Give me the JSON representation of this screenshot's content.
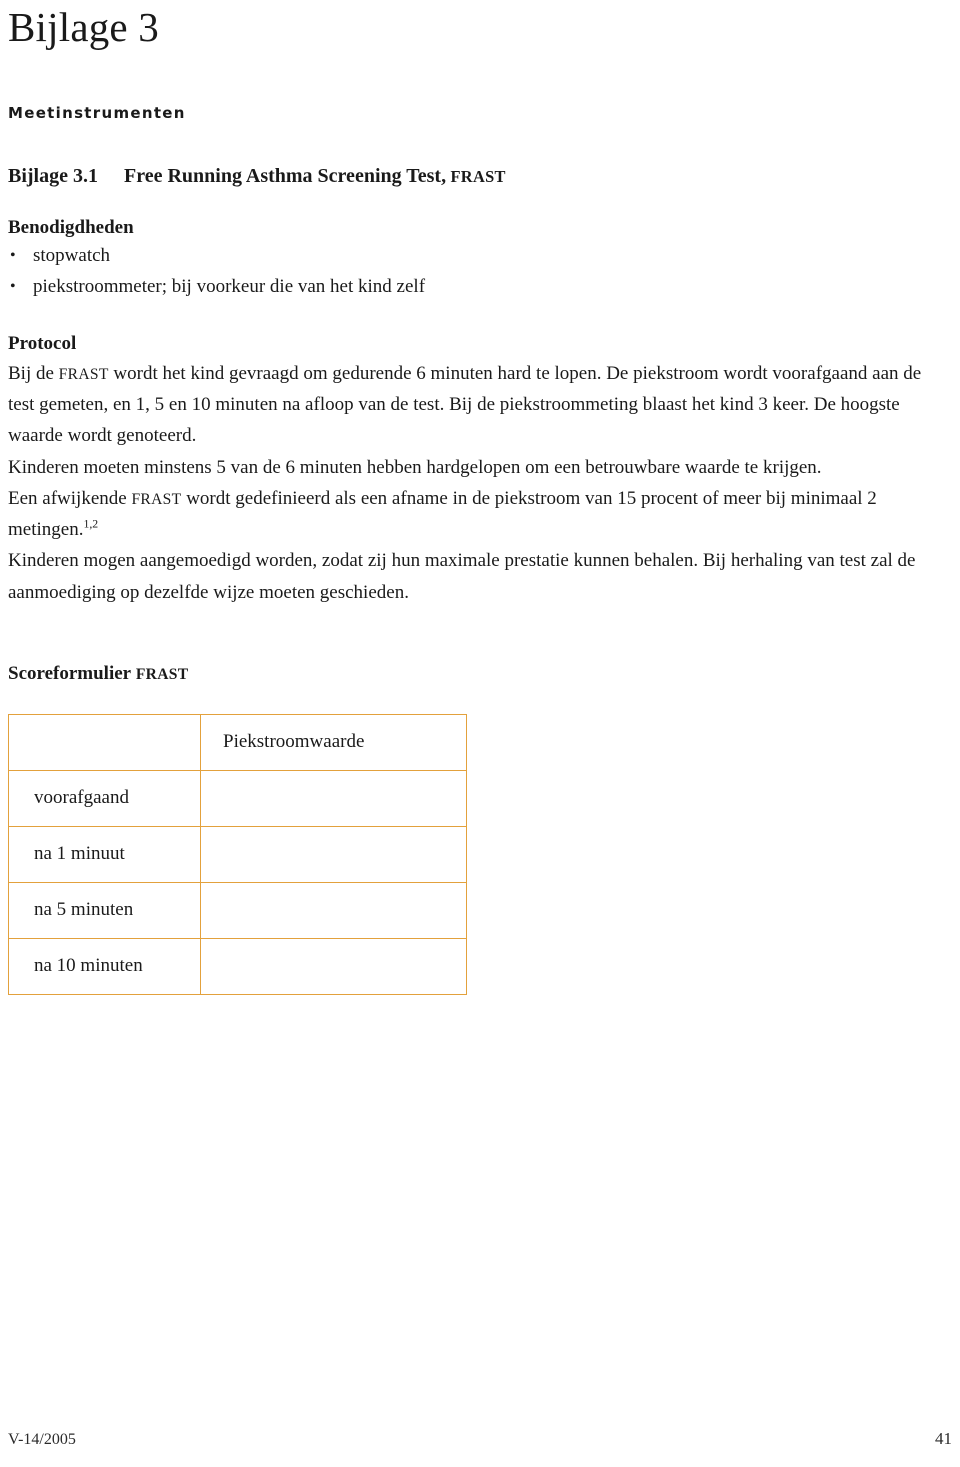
{
  "document": {
    "title": "Bijlage 3",
    "section_heading": "Meetinstrumenten"
  },
  "subtitle": {
    "number": "Bijlage 3.1",
    "text": "Free Running Asthma Screening Test,",
    "acronym": "FRAST"
  },
  "benodigdheden": {
    "heading": "Benodigdheden",
    "bullet_glyph": "•",
    "items": [
      "stopwatch",
      "piekstroommeter; bij voorkeur die van het kind zelf"
    ]
  },
  "protocol": {
    "heading": "Protocol",
    "para1_pre": "Bij de ",
    "para1_acronym": "FRAST",
    "para1_post": " wordt het kind gevraagd om gedurende 6 minuten hard te lopen. De piekstroom wordt voorafgaand aan de test gemeten, en 1, 5 en 10 minuten na afloop van de test. Bij de piekstroommeting blaast het kind 3 keer. De hoogste waarde wordt genoteerd.",
    "para2": "Kinderen moeten minstens 5 van de 6 minuten hebben hardgelopen om een betrouwbare waarde te krijgen.",
    "para3_pre": "Een afwijkende ",
    "para3_acronym": "FRAST",
    "para3_post": " wordt gedefinieerd als een afname in de piekstroom van 15 procent of meer bij minimaal 2 metingen.",
    "para3_superscript": "1,2",
    "para4": "Kinderen mogen aangemoedigd worden, zodat zij hun maximale prestatie kunnen behalen. Bij herhaling van test zal de aanmoediging op dezelfde wijze moeten geschieden."
  },
  "scoreformulier": {
    "heading": "Scoreformulier",
    "heading_acronym": "FRAST",
    "table": {
      "corner_cell": "",
      "value_column_header": "Piekstroomwaarde",
      "rows": [
        {
          "label": "voorafgaand",
          "value": ""
        },
        {
          "label": "na 1 minuut",
          "value": ""
        },
        {
          "label": "na 5 minuten",
          "value": ""
        },
        {
          "label": "na 10 minuten",
          "value": ""
        }
      ],
      "border_color": "#e3a13c"
    }
  },
  "footer": {
    "left": "V-14/2005",
    "right": "41"
  }
}
